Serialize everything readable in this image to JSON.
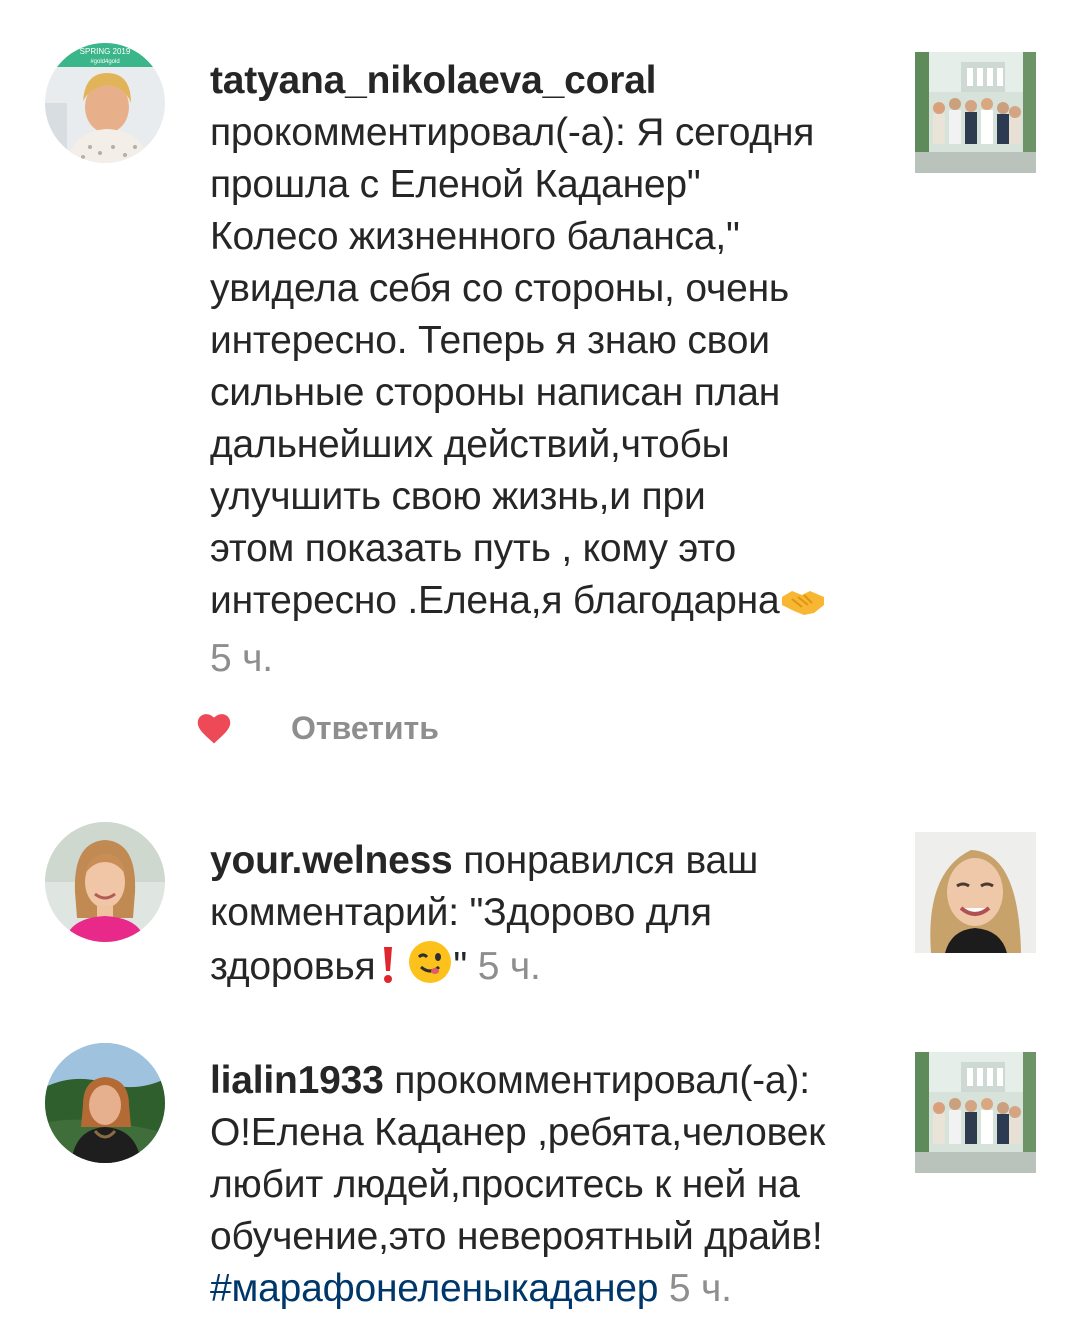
{
  "notifications": [
    {
      "username": "tatyana_nikolaeva_coral",
      "lines": [
        " прокомментировал(-а): Я сегодня",
        "прошла с Еленой Каданер\"",
        "Колесо жизненного баланса,\"",
        "увидела себя со стороны, очень",
        "интересно. Теперь я знаю свои",
        "сильные стороны написан план",
        "дальнейших действий,чтобы",
        "улучшить свою жизнь,и при",
        "этом показать путь , кому это",
        "интересно .Елена,я благодарна"
      ],
      "emoji": "handshake-emoji",
      "time": "5 ч.",
      "reply_label": "Ответить",
      "avatar_badge": "#gold4gold",
      "avatar_banner": "SPRING 2019",
      "liked": true
    },
    {
      "username": "your.welness",
      "line1_rest": " понравился ваш",
      "line2": "комментарий: \"Здорово для",
      "line3": "здоровья",
      "quote_close": "\"",
      "time": "5 ч."
    },
    {
      "username": "lialin1933",
      "line1_rest": " прокомментировал(-а):",
      "line2": "О!Елена Каданер ,ребята,человек",
      "line3": "любит людей,проситесь к ней на",
      "line4": "обучение,это невероятный драйв!",
      "hashtag": "#марафонеленыкаданер",
      "time": "5 ч."
    }
  ],
  "colors": {
    "text": "#262626",
    "muted": "#8e8e8e",
    "heart": "#ed4956",
    "hashtag": "#00376b"
  }
}
